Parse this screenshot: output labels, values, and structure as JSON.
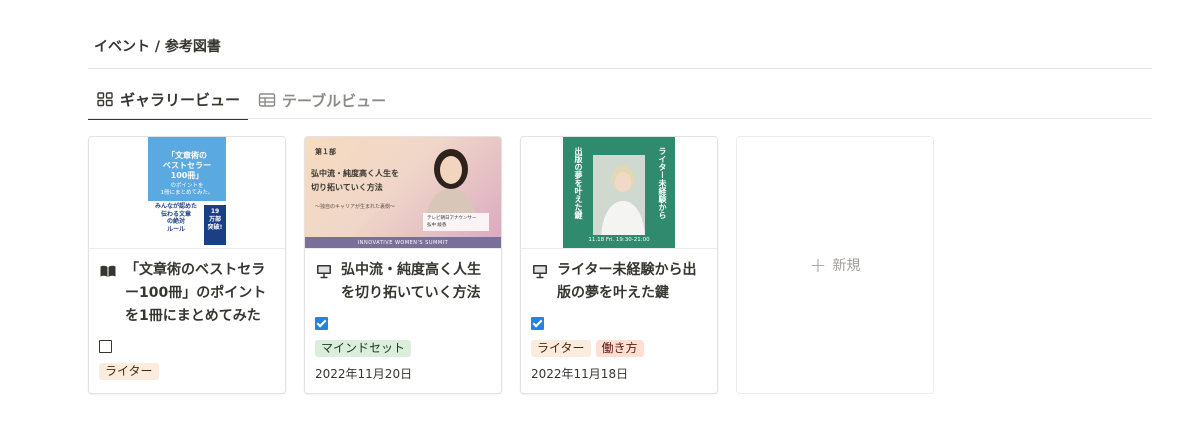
{
  "breadcrumb": "イベント / 参考図書",
  "tabs": [
    {
      "label": "ギャラリービュー",
      "icon": "gallery-icon",
      "active": true
    },
    {
      "label": "テーブルビュー",
      "icon": "table-icon",
      "active": false
    }
  ],
  "cards": [
    {
      "icon": "book-icon",
      "title": "「文章術のベストセラー100冊」のポイントを1冊にまとめてみた",
      "checked": false,
      "tags": [
        {
          "label": "ライター",
          "color": "orange"
        }
      ],
      "date": "",
      "cover": {
        "title": "「文章術の\nベストセラー\n100冊」",
        "subtitle": "のポイントを\n1冊にまとめてみた。",
        "highlight": "みんなが認めた\n伝わる文章\nの絶対\nルール",
        "badge": "19\n万部\n突破!"
      }
    },
    {
      "icon": "presentation-icon",
      "title": "弘中流・純度高く人生を切り拓いていく方法",
      "checked": true,
      "tags": [
        {
          "label": "マインドセット",
          "color": "green"
        }
      ],
      "date": "2022年11月20日",
      "cover": {
        "label": "第１部",
        "title": "弘中流・純度高く人生を\n切り拓いていく方法",
        "subtitle": "〜独自のキャリアが生まれた裏側〜",
        "caption": "テレビ朝日アナウンサー\n弘中 綾香",
        "footer": "INNOVATIVE WOMEN'S SUMMIT"
      }
    },
    {
      "icon": "presentation-icon",
      "title": "ライター未経験から出版の夢を叶えた鍵",
      "checked": true,
      "tags": [
        {
          "label": "ライター",
          "color": "orange"
        },
        {
          "label": "働き方",
          "color": "red"
        }
      ],
      "date": "2022年11月18日",
      "cover": {
        "vertical1": "ライター未経験から",
        "vertical2": "出版の夢を叶えた鍵",
        "footer": "11.18 Fri. 19:30-21:00"
      }
    }
  ],
  "new_card": {
    "label": "新規"
  }
}
